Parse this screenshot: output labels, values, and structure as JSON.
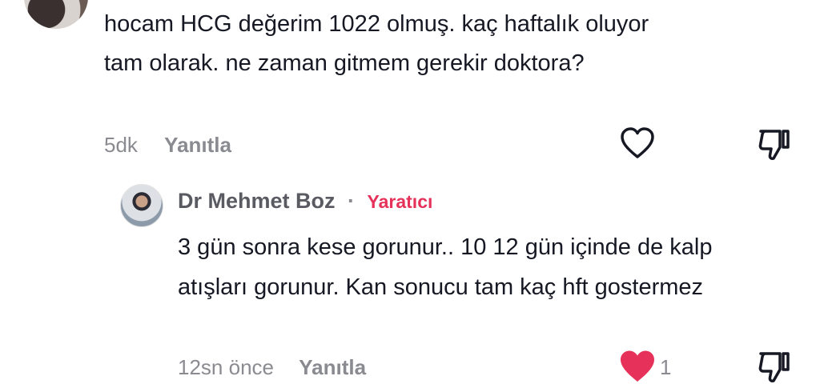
{
  "comment": {
    "text": "hocam HCG değerim 1022 olmuş. kaç haftalık oluyor tam olarak. ne zaman gitmem gerekir doktora?",
    "time": "5dk",
    "reply_label": "Yanıtla",
    "like_icon": "heart-outline",
    "dislike_icon": "thumbs-down-outline"
  },
  "reply": {
    "author": "Dr Mehmet Boz",
    "separator": "·",
    "badge": "Yaratıcı",
    "text": "3 gün sonra kese gorunur.. 10 12 gün içinde de kalp atışları gorunur. Kan sonucu tam kaç hft gostermez",
    "time": "12sn önce",
    "reply_label": "Yanıtla",
    "like_count": "1",
    "like_icon": "heart-filled",
    "like_color": "#e6325a",
    "dislike_icon": "thumbs-down-outline"
  },
  "colors": {
    "text": "#161823",
    "muted": "#8a8b91",
    "accent": "#e6325a"
  }
}
